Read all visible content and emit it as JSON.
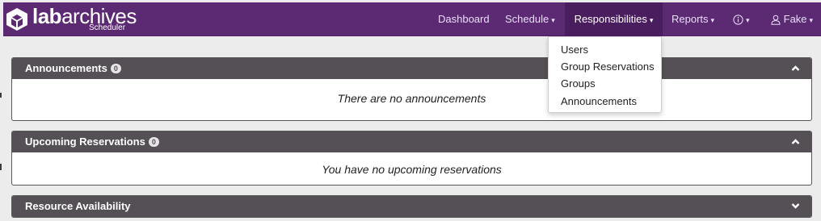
{
  "brand": {
    "name_bold": "lab",
    "name_light": "archives",
    "subtitle": "Scheduler"
  },
  "nav": {
    "dashboard": "Dashboard",
    "schedule": "Schedule",
    "responsibilities": "Responsibilities",
    "reports": "Reports",
    "user": "Fake",
    "caret": "▾"
  },
  "dropdown": {
    "items": [
      "Users",
      "Group Reservations",
      "Groups",
      "Announcements"
    ]
  },
  "panels": {
    "announcements": {
      "title": "Announcements",
      "count": "0",
      "empty_text": "There are no announcements"
    },
    "upcoming": {
      "title": "Upcoming Reservations",
      "count": "0",
      "empty_text": "You have no upcoming reservations"
    },
    "availability": {
      "title": "Resource Availability"
    }
  },
  "colors": {
    "navbar": "#5c2a73",
    "navbar_active": "#4a1d5f",
    "panel_header": "#555055"
  },
  "icons": {
    "logo": "labarchives-cube-logo",
    "info": "info-circle-icon",
    "user": "user-icon",
    "collapse": "chevron-up-icon",
    "expand": "chevron-down-icon"
  }
}
